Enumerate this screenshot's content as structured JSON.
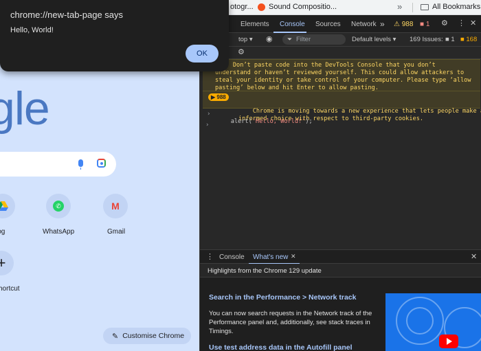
{
  "bookmarks": {
    "items": [
      {
        "label": "otogr..."
      },
      {
        "label": "Sound Compositio..."
      }
    ],
    "more_label": "»",
    "all_bookmarks": "All Bookmarks"
  },
  "ntp": {
    "logo_fragment": "gle",
    "tiles": [
      {
        "label": "log",
        "icon": "google-drive-icon"
      },
      {
        "label": "WhatsApp",
        "icon": "whatsapp-icon",
        "glyph": "✆"
      },
      {
        "label": "Gmail",
        "icon": "gmail-icon",
        "glyph": "M"
      },
      {
        "label": "hortcut",
        "icon": "plus-icon",
        "glyph": "+"
      }
    ],
    "customise_label": "Customise Chrome"
  },
  "dialog": {
    "title": "chrome://new-tab-page says",
    "message": "Hello, World!",
    "ok_label": "OK"
  },
  "devtools": {
    "tabs": [
      "Elements",
      "Console",
      "Sources",
      "Network"
    ],
    "active_tab": "Console",
    "more_tabs": "»",
    "warning_count": "988",
    "error_count": "1",
    "toolbar": {
      "context": "top",
      "filter_placeholder": "Filter",
      "levels": "Default levels",
      "issues_label": "169 Issues:",
      "issues_errors": "1",
      "issues_warnings": "168"
    },
    "console": {
      "self_xss_warning": "ing: Don’t paste code into the DevTools Console that you don’t\nunderstand or haven’t reviewed yourself. This could allow attackers to\nsteal your identity or take control of your computer. Please type ‘allow\npasting’ below and hit Enter to allow pasting.",
      "issue_badge": "988",
      "issue_message": "Chrome is moving towards a new experience that lets people make an\ninformed choice with respect to third-party cookies.",
      "command_prefix": "alert(",
      "command_string": "'Hello, World!'",
      "command_suffix": ");"
    },
    "drawer": {
      "tabs": [
        "Console",
        "What's new"
      ],
      "active_tab": "What's new",
      "subtitle": "Highlights from the Chrome 129 update",
      "heading1": "Search in the Performance > Network track",
      "body1": "You can now search requests in the Network track of the Performance panel and, additionally, see stack traces in Timings.",
      "heading2": "Use test address data in the Autofill panel"
    }
  },
  "colors": {
    "ntp_background": "#d3e3fd",
    "devtools_background": "#282828",
    "accent": "#a8c7fa",
    "warning": "#fdd663",
    "error": "#f28b82"
  }
}
